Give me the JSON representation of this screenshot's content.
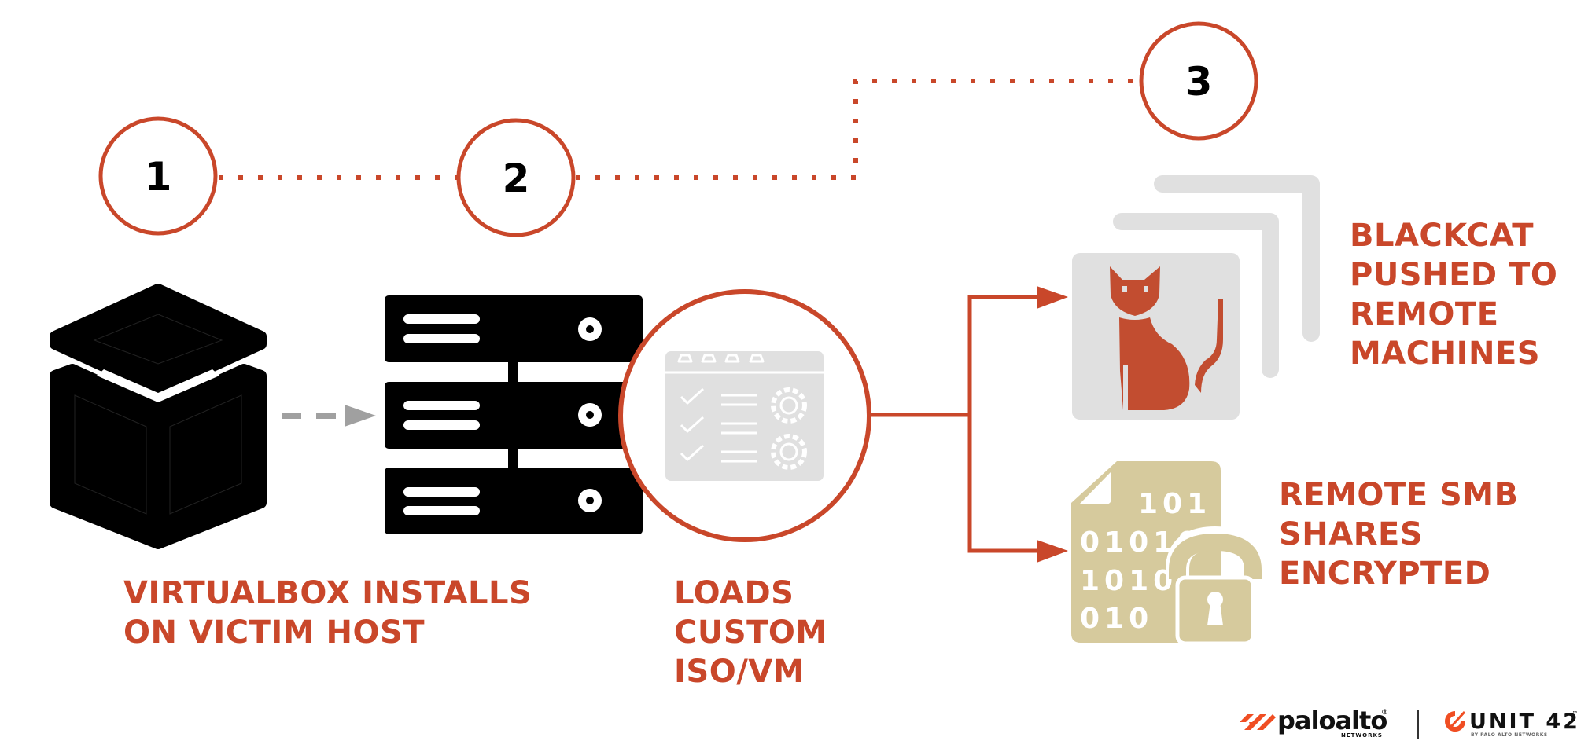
{
  "diagram": {
    "colors": {
      "accent": "#c9472a",
      "icon_dark": "#000000",
      "icon_gray": "#e0e0e0",
      "icon_tan": "#d6ca9d",
      "arrow_gray": "#a0a0a0"
    },
    "steps": [
      {
        "number": "1",
        "label_lines": [
          "VIRTUALBOX INSTALLS",
          "ON VICTIM HOST"
        ],
        "icon": "cube-icon"
      },
      {
        "number": "2",
        "label_lines": [
          "LOADS",
          "CUSTOM",
          "ISO/VM"
        ],
        "icon": "server-rack-icon"
      },
      {
        "number": "3",
        "icon": "blackcat-icon"
      }
    ],
    "intermediate_icon": "config-checklist-icon",
    "outcomes": [
      {
        "label_lines": [
          "BLACKCAT",
          "PUSHED TO",
          "REMOTE",
          "MACHINES"
        ],
        "icon": "cat-icon"
      },
      {
        "label_lines": [
          "REMOTE SMB",
          "SHARES",
          "ENCRYPTED"
        ],
        "icon": "encrypted-file-icon"
      }
    ],
    "binary_rows": [
      "101",
      "01010",
      "1010",
      "010"
    ]
  },
  "footer": {
    "brand1": {
      "name": "paloalto",
      "registered": "®",
      "sub": "NETWORKS"
    },
    "brand2": {
      "name": "UNIT 42",
      "tm": "™",
      "sub": "BY PALO ALTO NETWORKS"
    }
  }
}
